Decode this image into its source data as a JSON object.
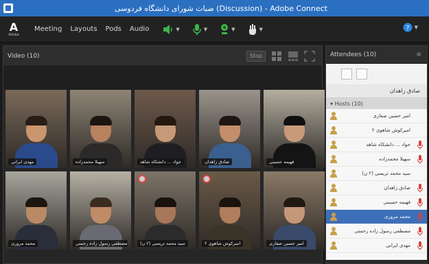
{
  "window": {
    "title": "ضبات شورای دانشگاه فردوسی (Discussion) - Adobe Connect"
  },
  "menubar": {
    "logo_text": "Adobe",
    "items": [
      "Meeting",
      "Layouts",
      "Pods",
      "Audio"
    ]
  },
  "video_pod": {
    "title": "Video (10)",
    "stop_label": "Stop",
    "tiles": [
      {
        "name": "مهدی ایرانی",
        "skin": "#c9966f",
        "shirt": "#2a4a8c",
        "bg": "#7a6a5a",
        "hair": "#2a1d15",
        "record": false
      },
      {
        "name": "سهیلا محمدزاده",
        "skin": "#b9825e",
        "shirt": "#2c2a28",
        "bg": "#8e8576",
        "hair": "#1c1510",
        "record": false
      },
      {
        "name": "جواد ... دانشکاه شاهد",
        "skin": "#c69a78",
        "shirt": "#1e1e22",
        "bg": "#6e5a4c",
        "hair": "#25180f",
        "record": false
      },
      {
        "name": "صادق زاهدان",
        "skin": "#c48e6a",
        "shirt": "#3b5f8e",
        "bg": "#9a948c",
        "hair": "#1e1610",
        "record": false
      },
      {
        "name": "فهیمه حسینی",
        "skin": "#c99a7a",
        "shirt": "#141414",
        "bg": "#b4aea0",
        "hair": "#101010",
        "record": false
      },
      {
        "name": "محمد مروری",
        "skin": "#ba8a66",
        "shirt": "#2a2d3a",
        "bg": "#a9a69e",
        "hair": "#1d1510",
        "record": false
      },
      {
        "name": "مصطفی رسول زاده رحمتی",
        "skin": "#c08c68",
        "shirt": "#6a6a72",
        "bg": "#b7b2a6",
        "hair": "#3a2c20",
        "record": false
      },
      {
        "name": "سید محمد تریسی (۲ ن)",
        "skin": "#a9775a",
        "shirt": "#2b2b2b",
        "bg": "#7d7468",
        "hair": "#1a130d",
        "record": true
      },
      {
        "name": "امیرکوش شاهوی ۲",
        "skin": "#b07e5c",
        "shirt": "#3a3328",
        "bg": "#6a5a48",
        "hair": "#1b140e",
        "record": true
      },
      {
        "name": "امیر حسین صفاری",
        "skin": "#c5977a",
        "shirt": "#3a4a6a",
        "bg": "#8a7a68",
        "hair": "#221a12",
        "record": false
      }
    ]
  },
  "attendees": {
    "title": "Attendees (10)",
    "host": "صادق زاهدان",
    "section": "Hosts (10)",
    "items": [
      {
        "name": "امیر حسین صفاری",
        "selected": false,
        "mic": false
      },
      {
        "name": "امیرکوش شاهوی ۲",
        "selected": false,
        "mic": false
      },
      {
        "name": "جواد ... دانشکاه شاهد",
        "selected": false,
        "mic": true
      },
      {
        "name": "سهیلا محمدزاده",
        "selected": false,
        "mic": true
      },
      {
        "name": "سید محمد تریسی (۲ ن)",
        "selected": false,
        "mic": false
      },
      {
        "name": "صادق زاهدان",
        "selected": false,
        "mic": true
      },
      {
        "name": "فهیمه حسینی",
        "selected": false,
        "mic": true
      },
      {
        "name": "محمد مروری",
        "selected": true,
        "mic": true
      },
      {
        "name": "مصطفی رسول زاده رحمتی",
        "selected": false,
        "mic": true
      },
      {
        "name": "مهدی ایرانی",
        "selected": false,
        "mic": true
      }
    ]
  },
  "colors": {
    "titlebar": "#2a6fc0",
    "selected_row": "#3d6fb8",
    "mic_red": "#d9403a",
    "green_icon": "#3db54a"
  }
}
